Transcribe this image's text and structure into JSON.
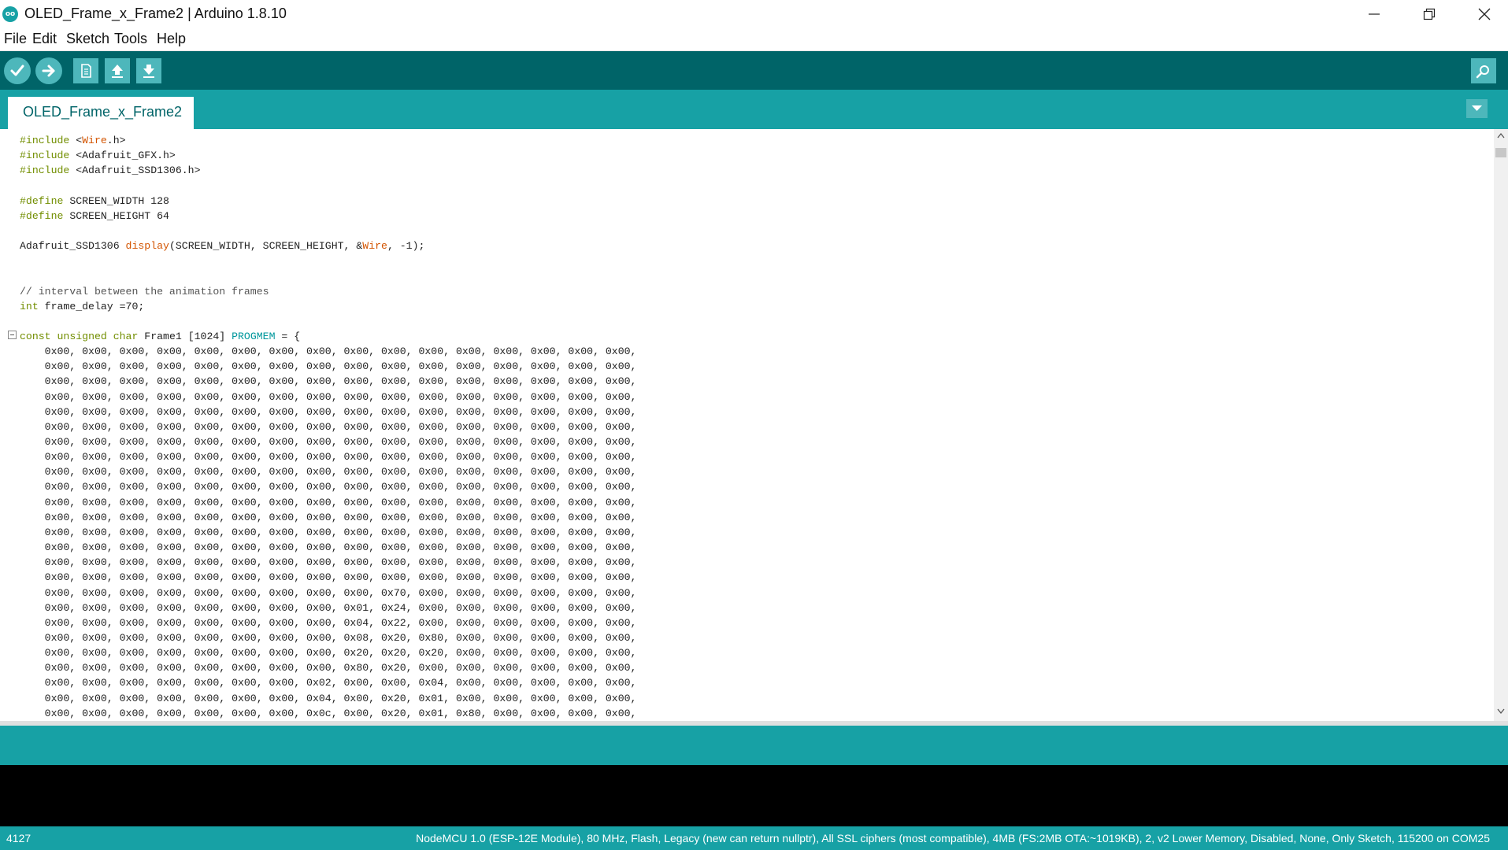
{
  "window": {
    "title": "OLED_Frame_x_Frame2 | Arduino 1.8.10",
    "logo_text": "oo",
    "controls": [
      "minimize-icon",
      "restore-icon",
      "close-icon"
    ]
  },
  "menu": {
    "items": [
      {
        "label": "File"
      },
      {
        "label": "Edit"
      },
      {
        "label": "Sketch"
      },
      {
        "label": "Tools"
      },
      {
        "label": "Help"
      }
    ]
  },
  "toolbar": {
    "buttons": [
      "verify-icon",
      "upload-icon",
      "new-icon",
      "open-icon",
      "save-icon",
      "serial-monitor-icon"
    ]
  },
  "tabs": {
    "active": {
      "label": "OLED_Frame_x_Frame2"
    }
  },
  "code": {
    "lines": [
      "#include <Wire.h>",
      "#include <Adafruit_GFX.h>",
      "#include <Adafruit_SSD1306.h>",
      "",
      "#define SCREEN_WIDTH 128",
      "#define SCREEN_HEIGHT 64",
      "",
      "Adafruit_SSD1306 display(SCREEN_WIDTH, SCREEN_HEIGHT, &Wire, -1);",
      "",
      "",
      "// interval between the animation frames",
      "int frame_delay =70;",
      "",
      "const unsigned char Frame1 [1024] PROGMEM = {",
      "    0x00, 0x00, 0x00, 0x00, 0x00, 0x00, 0x00, 0x00, 0x00, 0x00, 0x00, 0x00, 0x00, 0x00, 0x00, 0x00,",
      "    0x00, 0x00, 0x00, 0x00, 0x00, 0x00, 0x00, 0x00, 0x00, 0x00, 0x00, 0x00, 0x00, 0x00, 0x00, 0x00,",
      "    0x00, 0x00, 0x00, 0x00, 0x00, 0x00, 0x00, 0x00, 0x00, 0x00, 0x00, 0x00, 0x00, 0x00, 0x00, 0x00,",
      "    0x00, 0x00, 0x00, 0x00, 0x00, 0x00, 0x00, 0x00, 0x00, 0x00, 0x00, 0x00, 0x00, 0x00, 0x00, 0x00,",
      "    0x00, 0x00, 0x00, 0x00, 0x00, 0x00, 0x00, 0x00, 0x00, 0x00, 0x00, 0x00, 0x00, 0x00, 0x00, 0x00,",
      "    0x00, 0x00, 0x00, 0x00, 0x00, 0x00, 0x00, 0x00, 0x00, 0x00, 0x00, 0x00, 0x00, 0x00, 0x00, 0x00,",
      "    0x00, 0x00, 0x00, 0x00, 0x00, 0x00, 0x00, 0x00, 0x00, 0x00, 0x00, 0x00, 0x00, 0x00, 0x00, 0x00,",
      "    0x00, 0x00, 0x00, 0x00, 0x00, 0x00, 0x00, 0x00, 0x00, 0x00, 0x00, 0x00, 0x00, 0x00, 0x00, 0x00,",
      "    0x00, 0x00, 0x00, 0x00, 0x00, 0x00, 0x00, 0x00, 0x00, 0x00, 0x00, 0x00, 0x00, 0x00, 0x00, 0x00,",
      "    0x00, 0x00, 0x00, 0x00, 0x00, 0x00, 0x00, 0x00, 0x00, 0x00, 0x00, 0x00, 0x00, 0x00, 0x00, 0x00,",
      "    0x00, 0x00, 0x00, 0x00, 0x00, 0x00, 0x00, 0x00, 0x00, 0x00, 0x00, 0x00, 0x00, 0x00, 0x00, 0x00,",
      "    0x00, 0x00, 0x00, 0x00, 0x00, 0x00, 0x00, 0x00, 0x00, 0x00, 0x00, 0x00, 0x00, 0x00, 0x00, 0x00,",
      "    0x00, 0x00, 0x00, 0x00, 0x00, 0x00, 0x00, 0x00, 0x00, 0x00, 0x00, 0x00, 0x00, 0x00, 0x00, 0x00,",
      "    0x00, 0x00, 0x00, 0x00, 0x00, 0x00, 0x00, 0x00, 0x00, 0x00, 0x00, 0x00, 0x00, 0x00, 0x00, 0x00,",
      "    0x00, 0x00, 0x00, 0x00, 0x00, 0x00, 0x00, 0x00, 0x00, 0x00, 0x00, 0x00, 0x00, 0x00, 0x00, 0x00,",
      "    0x00, 0x00, 0x00, 0x00, 0x00, 0x00, 0x00, 0x00, 0x00, 0x00, 0x00, 0x00, 0x00, 0x00, 0x00, 0x00,",
      "    0x00, 0x00, 0x00, 0x00, 0x00, 0x00, 0x00, 0x00, 0x00, 0x70, 0x00, 0x00, 0x00, 0x00, 0x00, 0x00,",
      "    0x00, 0x00, 0x00, 0x00, 0x00, 0x00, 0x00, 0x00, 0x01, 0x24, 0x00, 0x00, 0x00, 0x00, 0x00, 0x00,",
      "    0x00, 0x00, 0x00, 0x00, 0x00, 0x00, 0x00, 0x00, 0x04, 0x22, 0x00, 0x00, 0x00, 0x00, 0x00, 0x00,",
      "    0x00, 0x00, 0x00, 0x00, 0x00, 0x00, 0x00, 0x00, 0x08, 0x20, 0x80, 0x00, 0x00, 0x00, 0x00, 0x00,",
      "    0x00, 0x00, 0x00, 0x00, 0x00, 0x00, 0x00, 0x00, 0x20, 0x20, 0x20, 0x00, 0x00, 0x00, 0x00, 0x00,",
      "    0x00, 0x00, 0x00, 0x00, 0x00, 0x00, 0x00, 0x00, 0x80, 0x20, 0x00, 0x00, 0x00, 0x00, 0x00, 0x00,",
      "    0x00, 0x00, 0x00, 0x00, 0x00, 0x00, 0x00, 0x02, 0x00, 0x00, 0x04, 0x00, 0x00, 0x00, 0x00, 0x00,",
      "    0x00, 0x00, 0x00, 0x00, 0x00, 0x00, 0x00, 0x04, 0x00, 0x20, 0x01, 0x00, 0x00, 0x00, 0x00, 0x00,",
      "    0x00, 0x00, 0x00, 0x00, 0x00, 0x00, 0x00, 0x0c, 0x00, 0x20, 0x01, 0x80, 0x00, 0x00, 0x00, 0x00,"
    ]
  },
  "console": {
    "message": ""
  },
  "status": {
    "line_number": "4127",
    "board_info": "NodeMCU 1.0 (ESP-12E Module), 80 MHz, Flash, Legacy (new can return nullptr), All SSL ciphers (most compatible), 4MB (FS:2MB OTA:~1019KB), 2, v2 Lower Memory, Disabled, None, Only Sketch, 115200 on COM25"
  },
  "colors": {
    "toolbar_bg": "#006468",
    "tab_bar_bg": "#17a1a5",
    "button_bg": "#4db7bb",
    "keyword": "#728e00",
    "function": "#d35400",
    "type_token": "#00979c",
    "console_bg": "#000000"
  }
}
